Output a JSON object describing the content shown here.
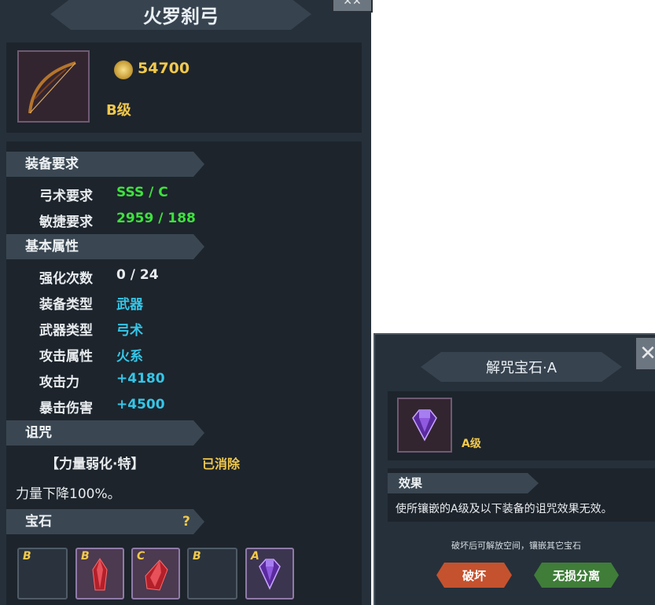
{
  "item": {
    "name": "火罗刹弓",
    "price": "54700",
    "grade": "B级"
  },
  "sections": {
    "requirements_title": "装备要求",
    "basic_title": "基本属性",
    "curse_title": "诅咒",
    "gem_title": "宝石",
    "gem_help": "?"
  },
  "requirements": [
    {
      "label": "弓术要求",
      "value": "SSS / C"
    },
    {
      "label": "敏捷要求",
      "value": "2959 / 188"
    }
  ],
  "attributes": [
    {
      "label": "强化次数",
      "value": "0 / 24"
    },
    {
      "label": "装备类型",
      "value": "武器"
    },
    {
      "label": "武器类型",
      "value": "弓术"
    },
    {
      "label": "攻击属性",
      "value": "火系"
    },
    {
      "label": "攻击力",
      "value": "+4180"
    },
    {
      "label": "暴击伤害",
      "value": "+4500"
    }
  ],
  "curse": {
    "name": "【力量弱化·特】",
    "status": "已消除",
    "description": "力量下降100%。"
  },
  "gem_slots": [
    {
      "grade": "B",
      "content": "empty"
    },
    {
      "grade": "B",
      "content": "red-crystal"
    },
    {
      "grade": "C",
      "content": "red-crystal"
    },
    {
      "grade": "B",
      "content": "empty"
    },
    {
      "grade": "A",
      "content": "purple-gem"
    }
  ],
  "popup": {
    "title": "解咒宝石·A",
    "grade": "A级",
    "effect_title": "效果",
    "effect_text": "使所镶嵌的A级及以下装备的诅咒效果无效。",
    "hint": "破坏后可解放空间，镶嵌其它宝石",
    "destroy_label": "破坏",
    "separate_label": "无损分离"
  },
  "colors": {
    "green_value": "#3de23d",
    "cyan_value": "#35c6e8",
    "gold": "#f2c94c",
    "destroy_btn": "#c4522f",
    "separate_btn": "#3f7d39"
  }
}
